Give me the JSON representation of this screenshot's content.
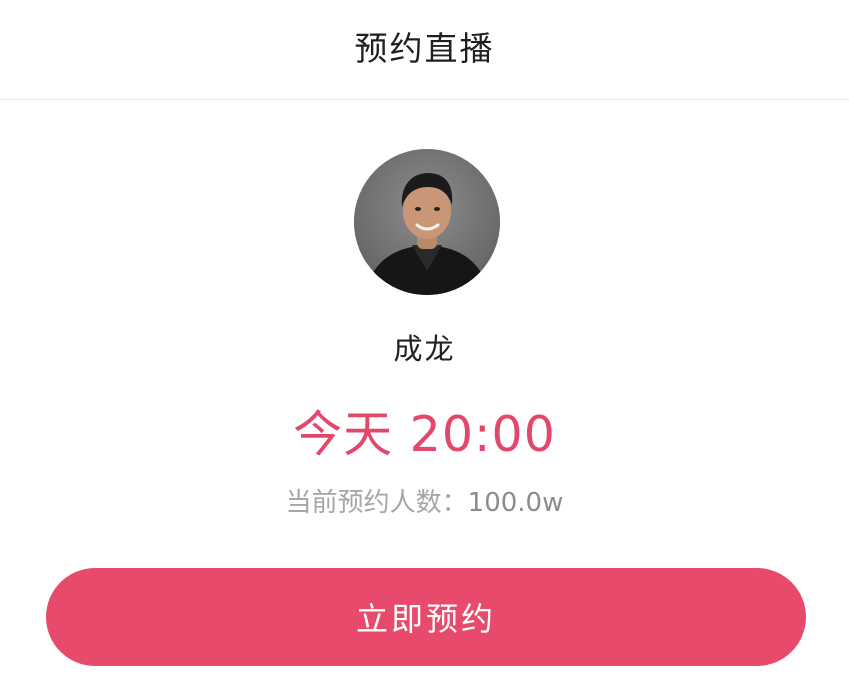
{
  "header": {
    "title": "预约直播"
  },
  "host": {
    "name": "成龙",
    "avatar": "host-portrait-avatar"
  },
  "schedule": {
    "time": "今天 20:00"
  },
  "reservations": {
    "label": "当前预约人数：",
    "count": "100.0w"
  },
  "action": {
    "button_label": "立即预约"
  },
  "colors": {
    "accent": "#e84a6c",
    "time_text": "#e2486a",
    "muted_text": "#a6a6a6",
    "title_text": "#1f1f1f",
    "divider": "#ececec"
  }
}
